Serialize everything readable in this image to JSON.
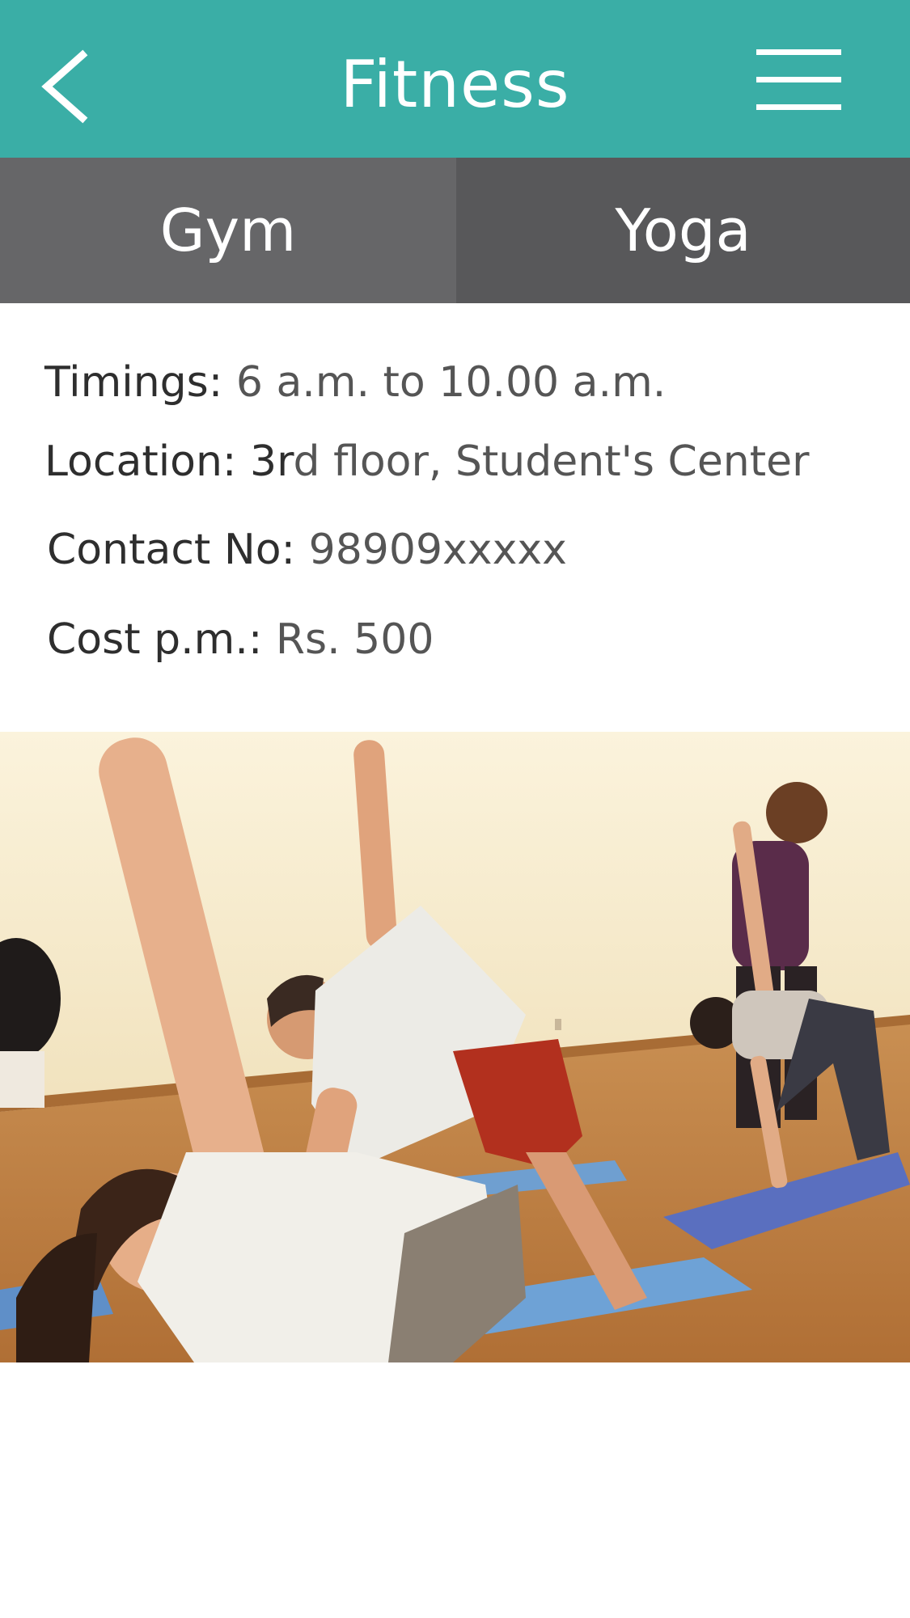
{
  "header": {
    "title": "Fitness",
    "background_color": "#3aaea6",
    "back_icon": "chevron-left-icon",
    "menu_icon": "hamburger-menu-icon"
  },
  "tabs": [
    {
      "label": "Gym"
    },
    {
      "label": "Yoga"
    }
  ],
  "info": {
    "timings_label": "Timings:",
    "timings_value": " 6 a.m. to 10.00 a.m.",
    "location_label": "Location: 3r",
    "location_value": "d floor, Student's Center",
    "contact_label": "Contact No:",
    "contact_value": " 98909xxxxx",
    "cost_label": "Cost p.m.:",
    "cost_value": " Rs. 500"
  }
}
